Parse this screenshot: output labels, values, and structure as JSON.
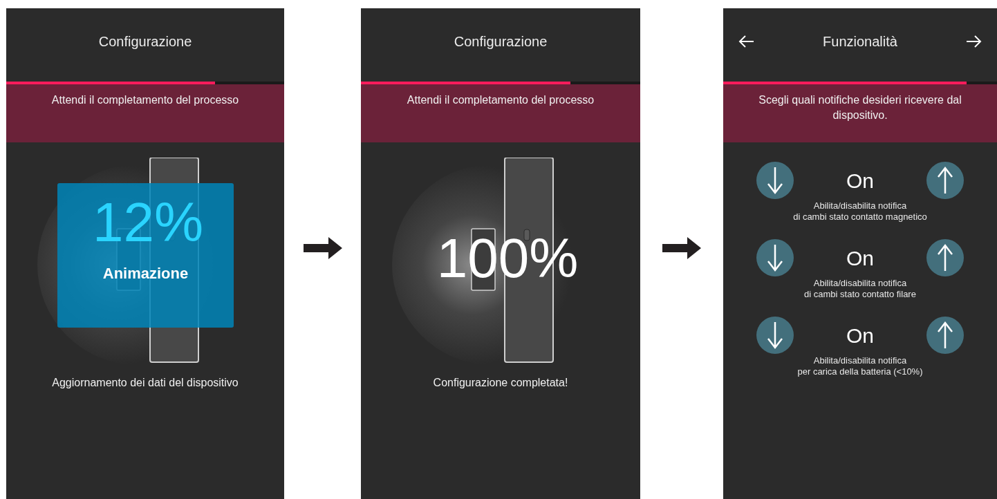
{
  "screens": [
    {
      "kind": "progress",
      "title": "Configurazione",
      "progress": {
        "level": 0.75
      },
      "banner": "Attendi il completamento del processo",
      "percent": "12%",
      "overlay": "Animazione",
      "caption": "Aggiornamento dei dati del dispositivo"
    },
    {
      "kind": "progress",
      "title": "Configurazione",
      "progress": {
        "level": 0.75
      },
      "banner": "Attendi il completamento del processo",
      "percent": "100%",
      "caption": "Configurazione completata!"
    },
    {
      "kind": "settings",
      "title": "Funzionalità",
      "progress": {
        "level": 0.89
      },
      "banner": "Scegli quali notifiche desideri ricevere dal dispositivo.",
      "rows": [
        {
          "value": "On",
          "description": "Abilita/disabilita notifica\ndi cambi stato contatto magnetico"
        },
        {
          "value": "On",
          "description": "Abilita/disabilita notifica\ndi cambi stato contatto filare"
        },
        {
          "value": "On",
          "description": "Abilita/disabilita notifica\nper carica della batteria (<10%)"
        }
      ]
    }
  ]
}
